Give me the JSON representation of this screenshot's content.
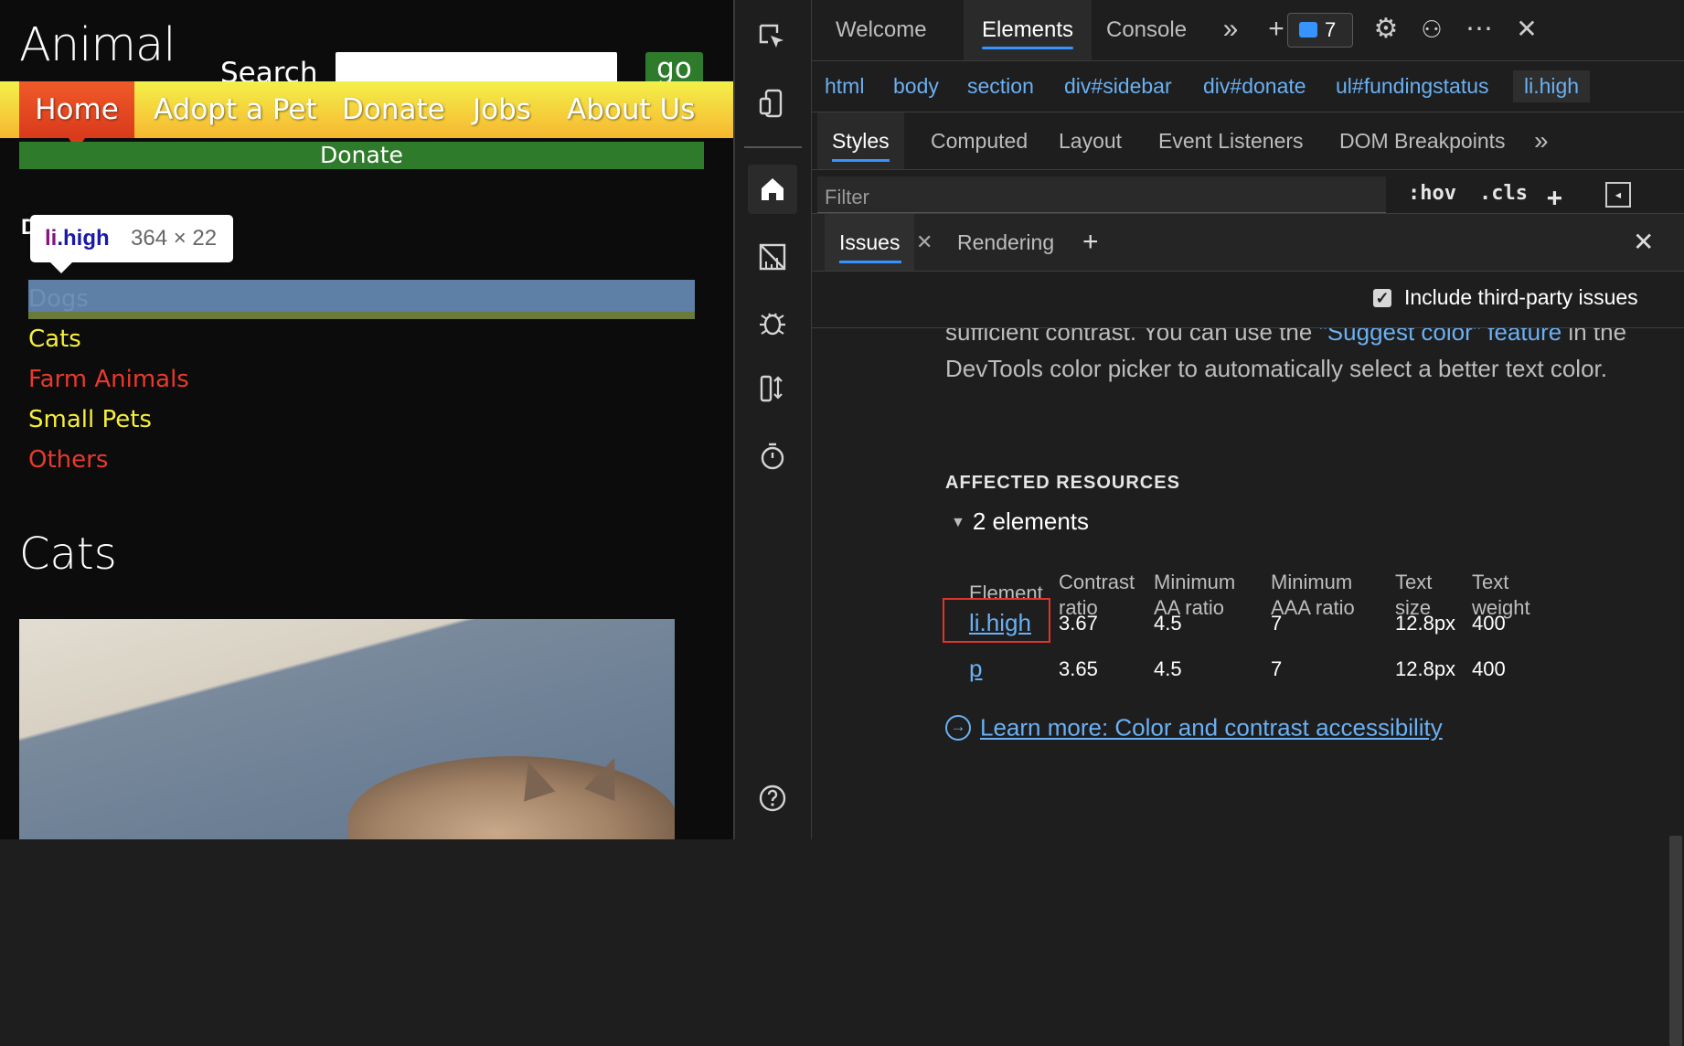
{
  "site": {
    "title": "Animal",
    "search_label": "Search",
    "search_value": "",
    "go_label": "go",
    "nav": [
      "Home",
      "Adopt a Pet",
      "Donate",
      "Jobs",
      "About Us"
    ],
    "donate_bar": "Donate",
    "sidebar_letter": "D",
    "tooltip_tag": "li",
    "tooltip_class": ".high",
    "tooltip_size": "364 × 22",
    "funding_items": [
      {
        "label": "Dogs",
        "color": "#6e8fb8"
      },
      {
        "label": "Cats",
        "color": "#f6ef3b"
      },
      {
        "label": "Farm Animals",
        "color": "#e8392c"
      },
      {
        "label": "Small Pets",
        "color": "#f6ef3b"
      },
      {
        "label": "Others",
        "color": "#e8392c"
      }
    ],
    "section_heading": "Cats"
  },
  "devtools": {
    "activity_icons": [
      "inspect-icon",
      "device-emulation-icon",
      "home-icon",
      "network-icon",
      "bug-icon",
      "performance-icon",
      "timer-icon",
      "help-icon"
    ],
    "main_tabs": [
      "Welcome",
      "Elements",
      "Console"
    ],
    "issues_count": "7",
    "breadcrumb": [
      "html",
      "body",
      "section",
      "div#sidebar",
      "div#donate",
      "ul#fundingstatus",
      "li.high"
    ],
    "sub_tabs": [
      "Styles",
      "Computed",
      "Layout",
      "Event Listeners",
      "DOM Breakpoints"
    ],
    "filter_placeholder": "Filter",
    "filter_tools": [
      ":hov",
      ".cls",
      "+"
    ],
    "drawer_tabs": [
      "Issues",
      "Rendering"
    ],
    "include_third_party": "Include third-party issues",
    "description_before": "sufficient contrast. You can use the ",
    "description_link": "\"Suggest color\" feature",
    "description_after": " in the DevTools color picker to automatically select a better text color.",
    "affected_heading": "AFFECTED RESOURCES",
    "elements_count": "2 elements",
    "table_headers": [
      [
        "Element"
      ],
      [
        "Contrast",
        "ratio"
      ],
      [
        "Minimum",
        "AA ratio"
      ],
      [
        "Minimum",
        "AAA ratio"
      ],
      [
        "Text",
        "size"
      ],
      [
        "Text",
        "weight"
      ]
    ],
    "rows": [
      {
        "element": "li.high",
        "contrast": "3.67",
        "aa": "4.5",
        "aaa": "7",
        "size": "12.8px",
        "weight": "400"
      },
      {
        "element": "p",
        "contrast": "3.65",
        "aa": "4.5",
        "aaa": "7",
        "size": "12.8px",
        "weight": "400"
      }
    ],
    "learn_more": "Learn more: Color and contrast accessibility"
  }
}
